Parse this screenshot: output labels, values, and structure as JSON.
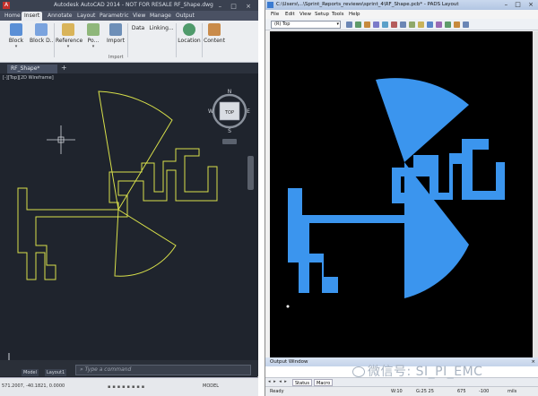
{
  "acad": {
    "title": "Autodesk AutoCAD 2014 - NOT FOR RESALE    RF_Shape.dwg",
    "app_logo": "A",
    "window_controls": "– □ ×",
    "tabs": [
      "Home",
      "Insert",
      "Annotate",
      "Layout",
      "Parametric",
      "View",
      "Manage",
      "Output"
    ],
    "active_tab": "Insert",
    "ribbon": {
      "block": "Block",
      "block_def": "Block D...",
      "reference": "Reference",
      "point_cloud": "Po...",
      "import": "Import",
      "data": "Data",
      "linking": "Linking...",
      "location": "Location",
      "content": "Content",
      "group_import": "Import"
    },
    "doc_tab": "RF_Shape*",
    "viewport_label": "[-][Top][2D Wireframe]",
    "viewcube": {
      "top": "TOP",
      "n": "N",
      "s": "S",
      "w": "W",
      "e": "E"
    },
    "layout_tabs": {
      "model": "Model",
      "layout1": "Layout1"
    },
    "command_placeholder": "Type a command",
    "coords": "571.2007, -40.1821, 0.0000",
    "model_label": "MODEL",
    "colors": {
      "outline": "#d8e04a",
      "bg": "#1f242d"
    }
  },
  "pads": {
    "title": "C:\\Users\\...\\Sprint_Reports_reviews\\sprint_4\\RF_Shape.pcb* - PADS Layout",
    "window_controls": "– □ ×",
    "menu": [
      "File",
      "Edit",
      "View",
      "Setup",
      "Tools",
      "Help"
    ],
    "layer_select": "(R) Top",
    "output_window_label": "Output Window",
    "output_tabs": {
      "status": "Status",
      "macro": "Macro"
    },
    "status": {
      "ready": "Ready",
      "w": "W:10",
      "g": "G:25 25",
      "x": "675",
      "y": "-100",
      "units": "mils"
    },
    "colors": {
      "shape": "#3b95ee",
      "bg": "#000000"
    }
  },
  "watermark": "微信号: SI_PI_EMC"
}
